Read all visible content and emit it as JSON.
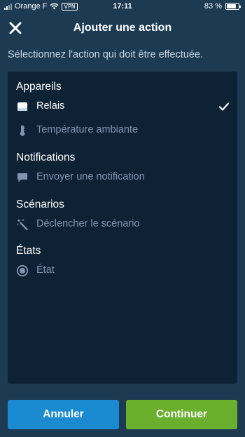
{
  "status_bar": {
    "carrier": "Orange F",
    "vpn": "VPN",
    "time": "17:11",
    "battery_percent_label": "83 %",
    "battery_level": 0.83
  },
  "header": {
    "title": "Ajouter une action",
    "close_icon": "close-icon"
  },
  "instruction": "Sélectionnez l'action qui doit être effectuée.",
  "sections": [
    {
      "title": "Appareils",
      "items": [
        {
          "label": "Relais",
          "icon": "relay-icon",
          "enabled": true,
          "selected": true
        },
        {
          "label": "Température ambiante",
          "icon": "thermometer-icon",
          "enabled": false,
          "selected": false
        }
      ]
    },
    {
      "title": "Notifications",
      "items": [
        {
          "label": "Envoyer une notification",
          "icon": "chat-bubble-icon",
          "enabled": false,
          "selected": false
        }
      ]
    },
    {
      "title": "Scénarios",
      "items": [
        {
          "label": "Déclencher le scénario",
          "icon": "magic-wand-icon",
          "enabled": false,
          "selected": false
        }
      ]
    },
    {
      "title": "États",
      "items": [
        {
          "label": "État",
          "icon": "radio-state-icon",
          "enabled": false,
          "selected": false
        }
      ]
    }
  ],
  "buttons": {
    "cancel": "Annuler",
    "continue": "Continuer"
  },
  "colors": {
    "background": "#1c3a52",
    "panel": "#0e2235",
    "disabled_text": "#7f96ad",
    "cancel_button": "#1a8ad1",
    "continue_button": "#6aaf2e"
  }
}
